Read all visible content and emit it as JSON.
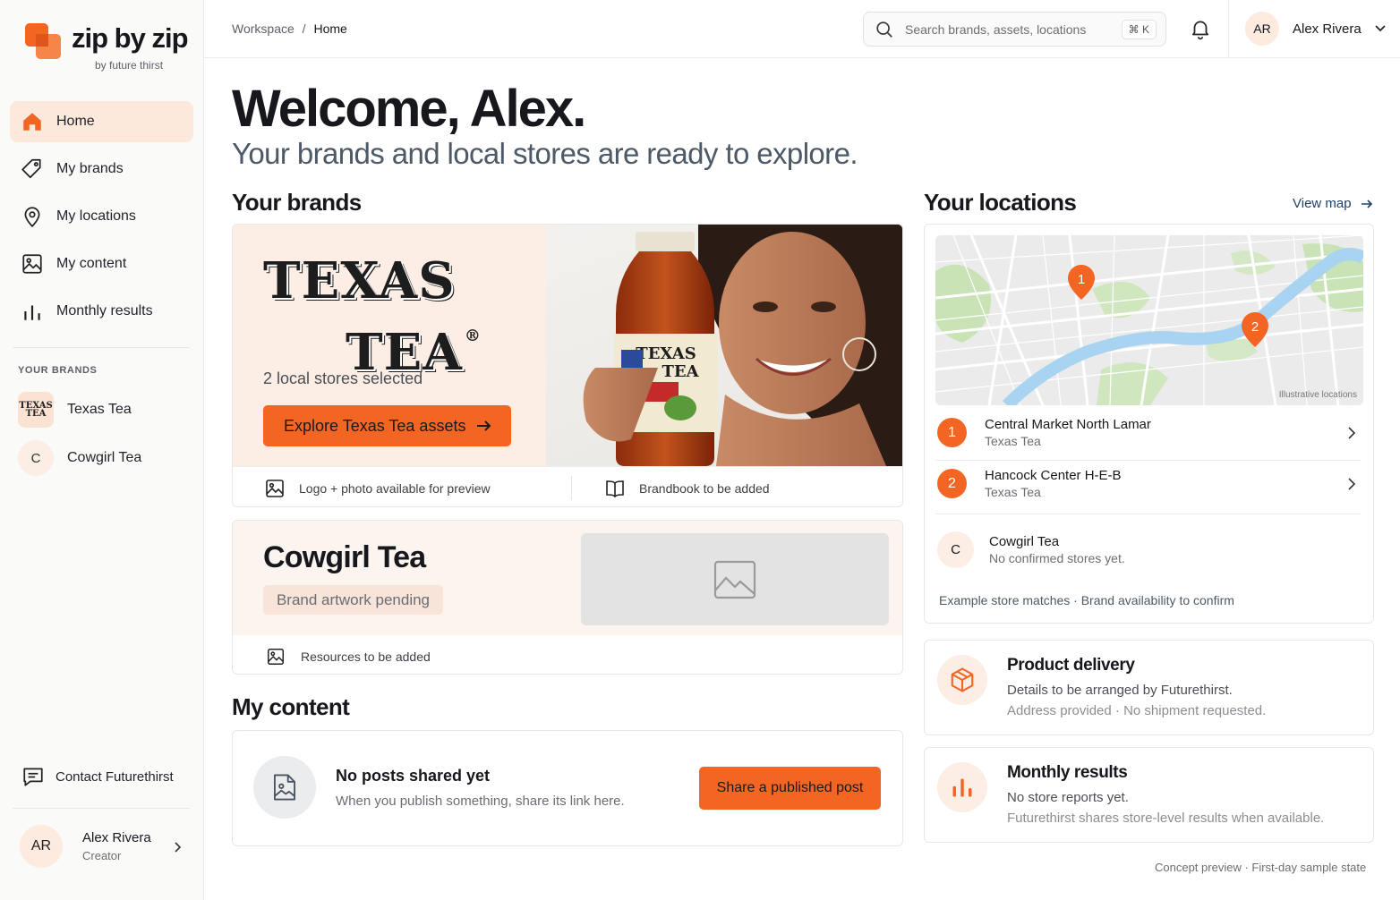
{
  "brand": {
    "name": "zip by zip",
    "tagline": "by future thirst"
  },
  "nav": {
    "items": [
      {
        "label": "Home",
        "icon": "home-icon"
      },
      {
        "label": "My brands",
        "icon": "tag-icon"
      },
      {
        "label": "My locations",
        "icon": "location-pin-icon"
      },
      {
        "label": "My content",
        "icon": "image-icon"
      },
      {
        "label": "Monthly results",
        "icon": "bar-chart-icon"
      }
    ]
  },
  "sidebar": {
    "brands_label": "YOUR BRANDS",
    "brands": [
      {
        "name": "Texas Tea",
        "thumb": "TEXAS TEA"
      },
      {
        "name": "Cowgirl Tea",
        "thumb": "C"
      }
    ],
    "contact": "Contact Futurethirst",
    "profile": {
      "initials": "AR",
      "name": "Alex Rivera",
      "role": "Creator"
    }
  },
  "topbar": {
    "breadcrumb": {
      "parent": "Workspace",
      "separator": "/",
      "current": "Home"
    },
    "search_placeholder": "Search brands, assets, locations",
    "shortcut": "⌘ K",
    "user": {
      "initials": "AR",
      "name": "Alex Rivera"
    }
  },
  "welcome": {
    "title": "Welcome, Alex.",
    "subtitle": "Your brands and local stores are ready to explore."
  },
  "your_brands": {
    "heading": "Your brands",
    "texas_tea": {
      "logo_line1": "TEXAS",
      "logo_line2": "TEA",
      "registered": "®",
      "stores": "2 local stores selected",
      "cta": "Explore Texas Tea assets",
      "bottle_label_1": "TEXAS",
      "bottle_label_2": "TEA",
      "footer_1": "Logo + photo available for preview",
      "footer_2": "Brandbook to be added"
    },
    "cowgirl_tea": {
      "name": "Cowgirl Tea",
      "status": "Brand artwork pending",
      "footer": "Resources to be added"
    }
  },
  "my_content": {
    "heading": "My content",
    "empty_title": "No posts shared yet",
    "empty_desc": "When you publish something, share its link here.",
    "button": "Share a published post"
  },
  "your_locations": {
    "heading": "Your locations",
    "view_map": "View map",
    "map_note": "Illustrative locations",
    "pins": [
      "1",
      "2"
    ],
    "stores": [
      {
        "num": "1",
        "name": "Central Market North Lamar",
        "brand": "Texas Tea"
      },
      {
        "num": "2",
        "name": "Hancock Center H-E-B",
        "brand": "Texas Tea"
      }
    ],
    "cowgirl": {
      "initial": "C",
      "name": "Cowgirl Tea",
      "status": "No confirmed stores yet."
    },
    "footer": "Example store matches · Brand availability to confirm"
  },
  "product_delivery": {
    "title": "Product delivery",
    "line1": "Details to be arranged by Futurethirst.",
    "line2": "Address provided · No shipment requested."
  },
  "monthly_results": {
    "title": "Monthly results",
    "line1": "No store reports yet.",
    "line2": "Futurethirst shares store-level results when available."
  },
  "footnote": "Concept preview · First-day sample state",
  "colors": {
    "accent": "#f26522",
    "accent_soft": "#fde8dc",
    "text": "#16181d",
    "muted": "#6a6e74"
  }
}
